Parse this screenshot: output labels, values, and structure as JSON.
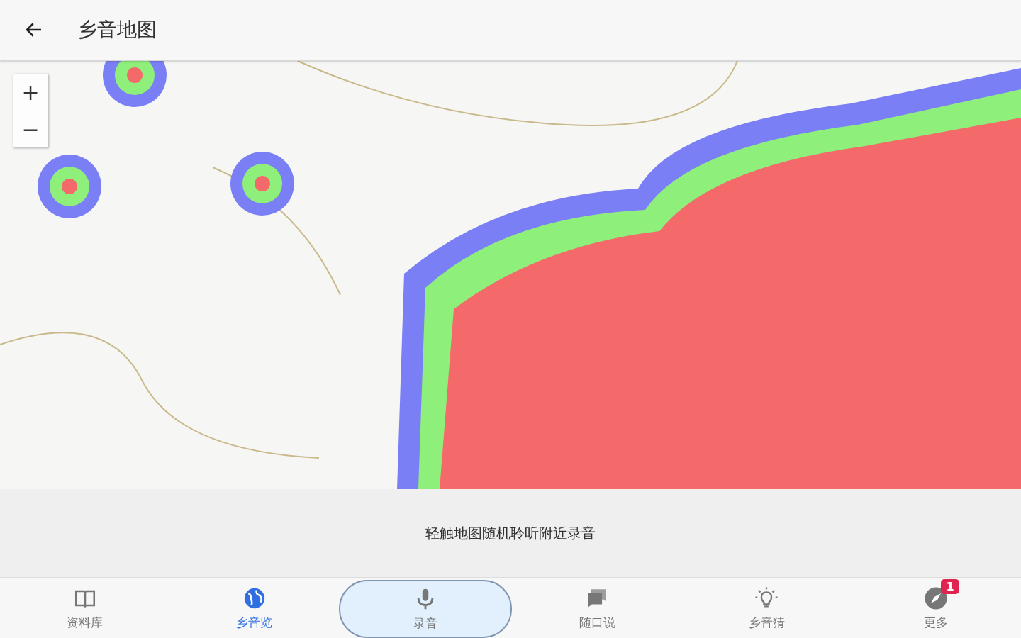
{
  "app_bar": {
    "title": "乡音地图"
  },
  "map": {
    "zoom_controls": [
      "+",
      "−"
    ]
  },
  "hint": "轻触地图随机聆听附近录音",
  "bottom_nav": [
    {
      "label": "资料库",
      "selected": false,
      "kind": "tab"
    },
    {
      "label": "乡音览",
      "selected": true,
      "kind": "tab"
    },
    {
      "label": "录音",
      "selected": false,
      "kind": "record"
    },
    {
      "label": "随口说",
      "selected": false,
      "kind": "tab"
    },
    {
      "label": "乡音猜",
      "selected": false,
      "kind": "tab"
    },
    {
      "label": "更多",
      "selected": false,
      "kind": "tab",
      "badge": "1"
    }
  ]
}
